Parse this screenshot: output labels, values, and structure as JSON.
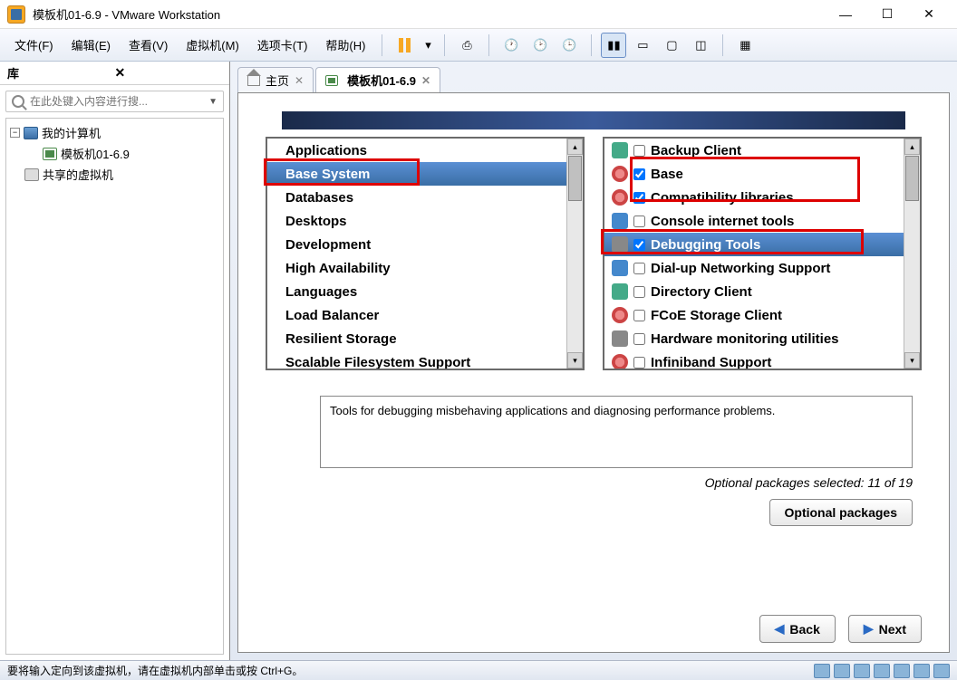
{
  "titlebar": {
    "text": "模板机01-6.9 - VMware Workstation"
  },
  "menubar": {
    "file": "文件(F)",
    "edit": "编辑(E)",
    "view": "查看(V)",
    "vm": "虚拟机(M)",
    "tabs": "选项卡(T)",
    "help": "帮助(H)"
  },
  "sidebar": {
    "title": "库",
    "search_placeholder": "在此处键入内容进行搜...",
    "tree": {
      "root": "我的计算机",
      "vm": "模板机01-6.9",
      "shared": "共享的虚拟机"
    }
  },
  "tabs": {
    "home": "主页",
    "vm": "模板机01-6.9"
  },
  "categories": [
    "Applications",
    "Base System",
    "Databases",
    "Desktops",
    "Development",
    "High Availability",
    "Languages",
    "Load Balancer",
    "Resilient Storage",
    "Scalable Filesystem Support"
  ],
  "selected_category_index": 1,
  "packages": [
    {
      "label": "Backup Client",
      "checked": false,
      "icon": "db"
    },
    {
      "label": "Base",
      "checked": true,
      "icon": "gear"
    },
    {
      "label": "Compatibility libraries",
      "checked": true,
      "icon": "gear"
    },
    {
      "label": "Console internet tools",
      "checked": false,
      "icon": "net"
    },
    {
      "label": "Debugging Tools",
      "checked": true,
      "icon": "tools",
      "selected": true
    },
    {
      "label": "Dial-up Networking Support",
      "checked": false,
      "icon": "net"
    },
    {
      "label": "Directory Client",
      "checked": false,
      "icon": "db"
    },
    {
      "label": "FCoE Storage Client",
      "checked": false,
      "icon": "gear"
    },
    {
      "label": "Hardware monitoring utilities",
      "checked": false,
      "icon": "tools"
    },
    {
      "label": "Infiniband Support",
      "checked": false,
      "icon": "gear"
    }
  ],
  "description": "Tools for debugging misbehaving applications and diagnosing performance problems.",
  "selected_text": "Optional packages selected: 11 of 19",
  "optional_btn": "Optional packages",
  "back_btn": "Back",
  "next_btn": "Next",
  "statusbar_text": "要将输入定向到该虚拟机，请在虚拟机内部单击或按 Ctrl+G。"
}
